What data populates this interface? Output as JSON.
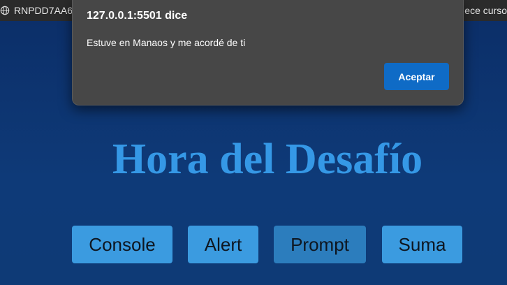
{
  "bookmarks_bar": {
    "left_item_label": "RNPDD7AA6",
    "right_item_label": "ece curso"
  },
  "page": {
    "title": "Hora del Desafío",
    "buttons": [
      {
        "label": "Console"
      },
      {
        "label": "Alert"
      },
      {
        "label": "Prompt",
        "state": "hover"
      },
      {
        "label": "Suma"
      }
    ]
  },
  "dialog": {
    "origin": "127.0.0.1:5501 dice",
    "message": "Estuve en Manaos y me acordé de ti",
    "ok_label": "Aceptar",
    "button_color": "#0f6bc6"
  },
  "colors": {
    "page_background": "#0e3370",
    "title": "#3598e6",
    "button": "#3b9be0",
    "button_hover": "#2c7dbd",
    "dialog_background": "#474747"
  },
  "icons": {
    "bookmark_left": "globe-icon"
  }
}
